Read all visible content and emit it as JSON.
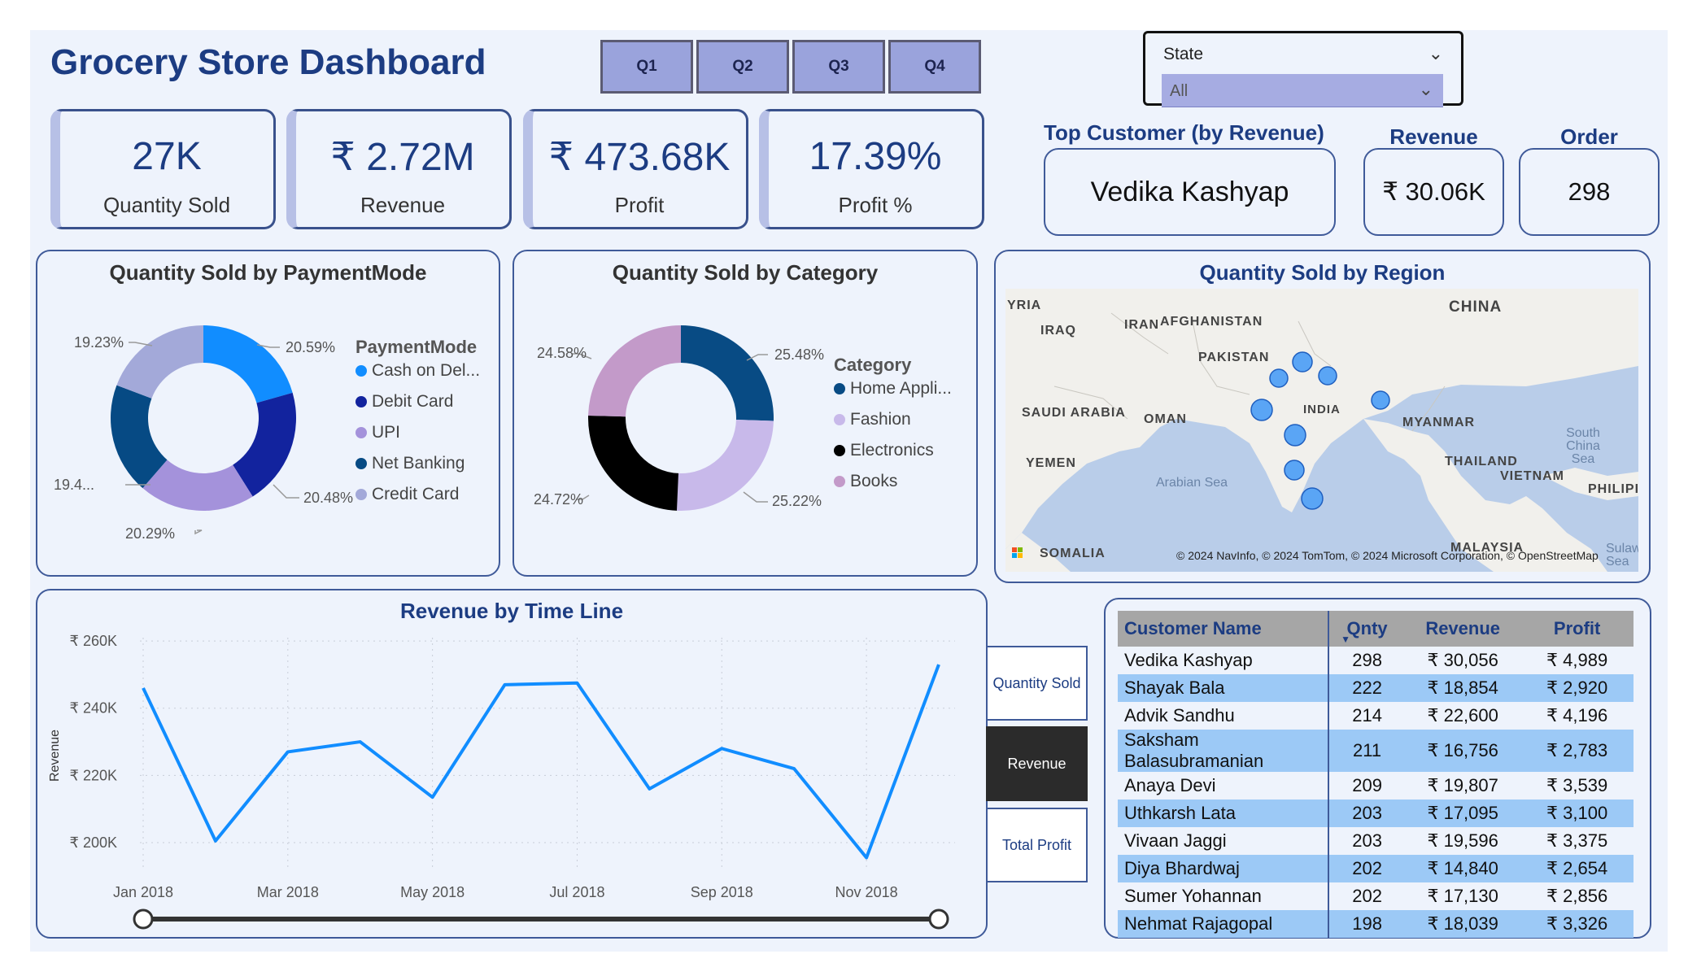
{
  "header": {
    "title": "Grocery Store Dashboard"
  },
  "quarters": [
    "Q1",
    "Q2",
    "Q3",
    "Q4"
  ],
  "state_slicer": {
    "label": "State",
    "value": "All"
  },
  "kpis": [
    {
      "value": "27K",
      "label": "Quantity Sold"
    },
    {
      "value": "₹ 2.72M",
      "label": "Revenue"
    },
    {
      "value": "₹ 473.68K",
      "label": "Profit"
    },
    {
      "value": "17.39%",
      "label": "Profit %"
    }
  ],
  "top_customer": {
    "heading": "Top Customer (by Revenue)",
    "name": "Vedika Kashyap",
    "revenue_heading": "Revenue",
    "revenue": "₹ 30.06K",
    "order_heading": "Order",
    "order": "298"
  },
  "payment_chart": {
    "title": "Quantity Sold by PaymentMode",
    "legend_title": "PaymentMode",
    "legend": [
      "Cash on Del...",
      "Debit Card",
      "UPI",
      "Net Banking",
      "Credit Card"
    ],
    "labels": [
      "20.59%",
      "20.48%",
      "20.29%",
      "19.4...",
      "19.23%"
    ]
  },
  "category_chart": {
    "title": "Quantity Sold by Category",
    "legend_title": "Category",
    "legend": [
      "Home Appli...",
      "Fashion",
      "Electronics",
      "Books"
    ],
    "labels": [
      "25.48%",
      "25.22%",
      "24.72%",
      "24.58%"
    ]
  },
  "region_map": {
    "title": "Quantity Sold by Region",
    "countries": [
      "CHINA",
      "IRAN",
      "AFGHANISTAN",
      "IRAQ",
      "PAKISTAN",
      "SAUDI ARABIA",
      "OMAN",
      "INDIA",
      "MYANMAR",
      "YEMEN",
      "THAILAND",
      "VIETNAM",
      "PHILIPI",
      "MALAYSIA",
      "SOMALIA",
      "YRIA"
    ],
    "seas": [
      "Arabian Sea",
      "South China Sea",
      "Sulawe Sea"
    ],
    "attribution": "© 2024 NavInfo, © 2024 TomTom, © 2024 Microsoft Corporation, © OpenStreetMap"
  },
  "metric_buttons": [
    "Quantity Sold",
    "Revenue",
    "Total Profit"
  ],
  "chart_data": [
    {
      "type": "pie",
      "title": "Quantity Sold by PaymentMode",
      "categories": [
        "Cash on Del...",
        "Debit Card",
        "UPI",
        "Net Banking",
        "Credit Card"
      ],
      "values": [
        20.59,
        20.48,
        20.29,
        19.41,
        19.23
      ],
      "colors": [
        "#118dff",
        "#12239e",
        "#a492db",
        "#064a84",
        "#a3a9d9"
      ],
      "legend": "right"
    },
    {
      "type": "pie",
      "title": "Quantity Sold by Category",
      "categories": [
        "Home Appli...",
        "Fashion",
        "Electronics",
        "Books"
      ],
      "values": [
        25.48,
        25.22,
        24.72,
        24.58
      ],
      "colors": [
        "#084b84",
        "#c8b9ea",
        "#000000",
        "#c39ac9"
      ],
      "legend": "right"
    },
    {
      "type": "line",
      "title": "Revenue by Time Line",
      "ylabel": "Revenue",
      "x": [
        "Jan 2018",
        "Feb 2018",
        "Mar 2018",
        "Apr 2018",
        "May 2018",
        "Jun 2018",
        "Jul 2018",
        "Aug 2018",
        "Sep 2018",
        "Oct 2018",
        "Nov 2018",
        "Dec 2018"
      ],
      "xticks": [
        "Jan 2018",
        "Mar 2018",
        "May 2018",
        "Jul 2018",
        "Sep 2018",
        "Nov 2018"
      ],
      "values": [
        246,
        200.5,
        227,
        230,
        213.5,
        247,
        247.5,
        216,
        228,
        222,
        195.5,
        253
      ],
      "yticks": [
        "₹ 200K",
        "₹ 220K",
        "₹ 240K",
        "₹ 260K"
      ],
      "ytick_values": [
        200,
        220,
        240,
        260
      ],
      "ylim": [
        192,
        261
      ],
      "color": "#118dff",
      "grid": true
    }
  ],
  "customers": {
    "headers": [
      "Customer Name",
      "Qnty",
      "Revenue",
      "Profit"
    ],
    "rows": [
      [
        "Vedika Kashyap",
        "298",
        "₹ 30,056",
        "₹ 4,989"
      ],
      [
        "Shayak Bala",
        "222",
        "₹ 18,854",
        "₹ 2,920"
      ],
      [
        "Advik Sandhu",
        "214",
        "₹ 22,600",
        "₹ 4,196"
      ],
      [
        "Saksham Balasubramanian",
        "211",
        "₹ 16,756",
        "₹ 2,783"
      ],
      [
        "Anaya Devi",
        "209",
        "₹ 19,807",
        "₹ 3,539"
      ],
      [
        "Uthkarsh Lata",
        "203",
        "₹ 17,095",
        "₹ 3,100"
      ],
      [
        "Vivaan Jaggi",
        "203",
        "₹ 19,596",
        "₹ 3,375"
      ],
      [
        "Diya Bhardwaj",
        "202",
        "₹ 14,840",
        "₹ 2,654"
      ],
      [
        "Sumer Yohannan",
        "202",
        "₹ 17,130",
        "₹ 2,856"
      ],
      [
        "Nehmat Rajagopal",
        "198",
        "₹ 18,039",
        "₹ 3,326"
      ]
    ]
  }
}
